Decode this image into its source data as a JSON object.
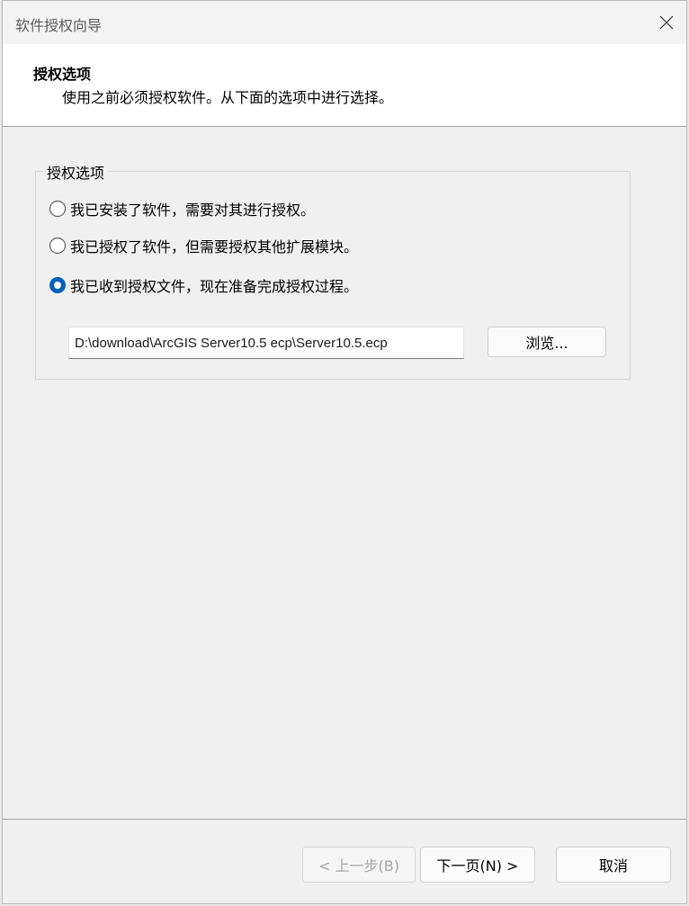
{
  "window": {
    "title": "软件授权向导"
  },
  "header": {
    "title": "授权选项",
    "subtitle": "使用之前必须授权软件。从下面的选项中进行选择。"
  },
  "group": {
    "legend": "授权选项",
    "options": [
      {
        "label": "我已安装了软件，需要对其进行授权。",
        "selected": false
      },
      {
        "label": "我已授权了软件，但需要授权其他扩展模块。",
        "selected": false
      },
      {
        "label": "我已收到授权文件，现在准备完成授权过程。",
        "selected": true
      }
    ],
    "file_path": "D:\\download\\ArcGIS Server10.5 ecp\\Server10.5.ecp",
    "browse_label": "浏览..."
  },
  "footer": {
    "back_label": "< 上一步(B)",
    "next_label": "下一页(N) >",
    "cancel_label": "取消"
  },
  "colors": {
    "accent": "#005fb8",
    "disabled_text": "#a6a6a6"
  }
}
